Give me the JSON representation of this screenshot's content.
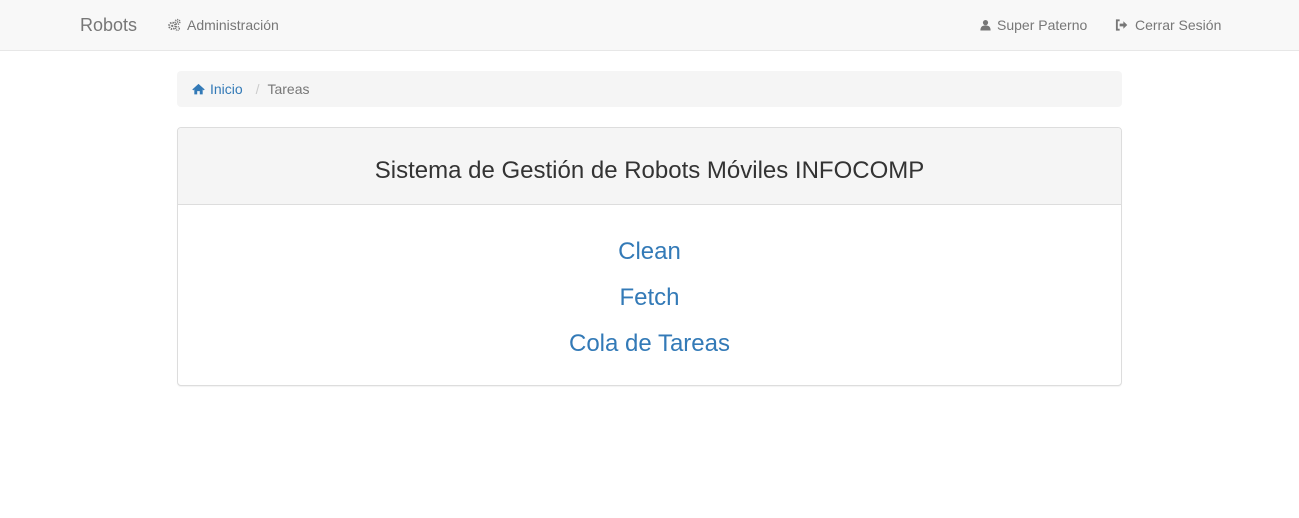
{
  "navbar": {
    "brand": "Robots",
    "admin_label": "Administración",
    "admin_icon": "gears-icon",
    "user_label": "Super Paterno",
    "user_icon": "user-icon",
    "logout_label": "Cerrar Sesión",
    "logout_icon": "sign-out-icon"
  },
  "breadcrumb": {
    "home_label": "Inicio",
    "home_icon": "home-icon",
    "separator": "/",
    "current": "Tareas"
  },
  "panel": {
    "title": "Sistema de Gestión de Robots Móviles INFOCOMP",
    "links": [
      {
        "label": "Clean"
      },
      {
        "label": "Fetch"
      },
      {
        "label": "Cola de Tareas"
      }
    ]
  },
  "colors": {
    "navbar_bg": "#f8f8f8",
    "nav_text": "#777777",
    "link": "#337ab7",
    "panel_heading_bg": "#f5f5f5",
    "border": "#dddddd"
  }
}
